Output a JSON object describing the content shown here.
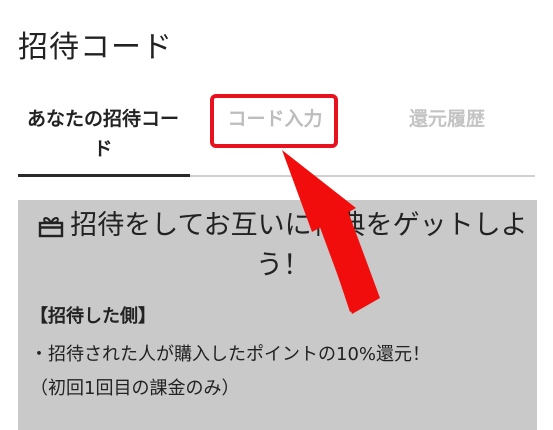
{
  "header": {
    "title": "招待コード"
  },
  "tabs": [
    {
      "label": "あなたの招待コード",
      "active": true
    },
    {
      "label": "コード入力",
      "active": false
    },
    {
      "label": "還元履歴",
      "active": false
    }
  ],
  "card": {
    "headline": "招待をしてお互いに特典をゲットしよう！",
    "section_label": "【招待した側】",
    "bullet": "・招待された人が購入したポイントの10%還元！",
    "note": "（初回1回目の課金のみ）"
  },
  "colors": {
    "highlight": "#e8121f",
    "arrow": "#f20d0d",
    "card_bg": "#c9c9c9",
    "inactive_tab": "#bdbdbd"
  },
  "icons": [
    "gift-icon",
    "pointer-arrow-icon"
  ]
}
